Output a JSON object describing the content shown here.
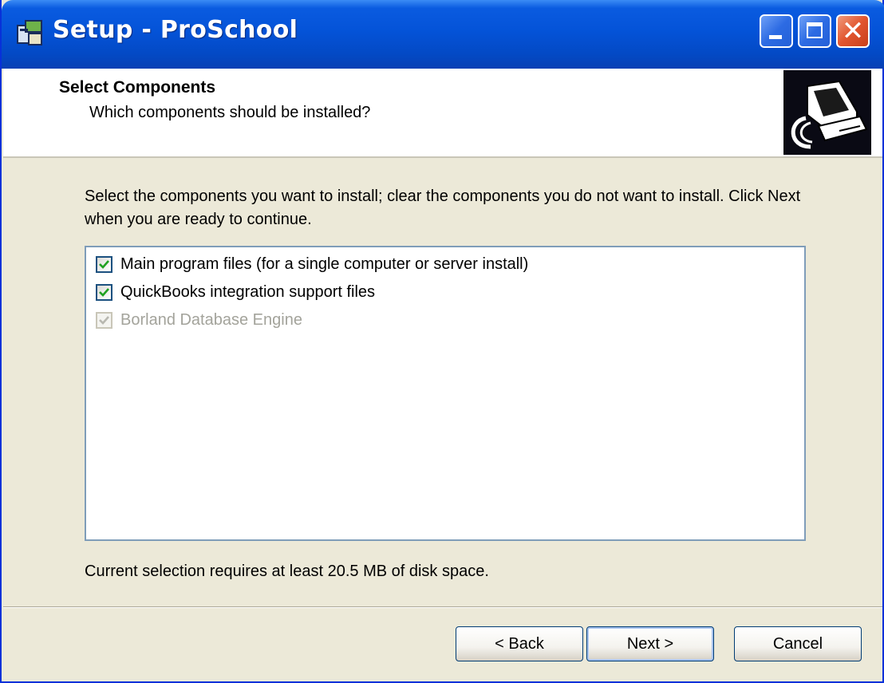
{
  "window": {
    "title": "Setup - ProSchool"
  },
  "header": {
    "title": "Select Components",
    "subtitle": "Which components should be installed?"
  },
  "body": {
    "instructions": "Select the components you want to install; clear the components you do not want to install. Click Next when you are ready to continue.",
    "components": [
      {
        "label": "Main program files (for a single computer or server install)",
        "checked": true,
        "enabled": true
      },
      {
        "label": "QuickBooks integration support files",
        "checked": true,
        "enabled": true
      },
      {
        "label": "Borland Database Engine",
        "checked": true,
        "enabled": false
      }
    ],
    "disk_space": "Current selection requires at least 20.5 MB of disk space."
  },
  "buttons": {
    "back": "< Back",
    "next": "Next >",
    "cancel": "Cancel"
  },
  "colors": {
    "titlebar": "#0453d8",
    "check": "#21a121",
    "check_disabled": "#b8b8b0"
  }
}
